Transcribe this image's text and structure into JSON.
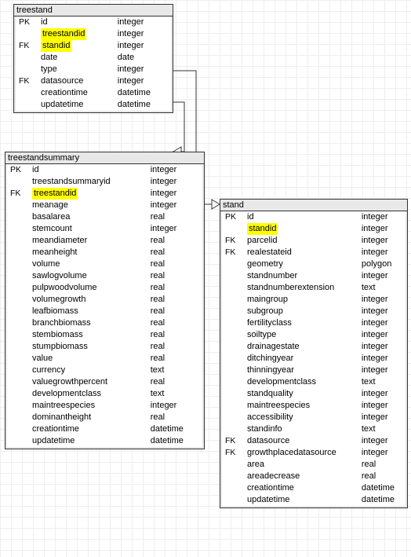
{
  "entities": {
    "treestand": {
      "title": "treestand",
      "rows": [
        {
          "key": "PK",
          "name": "id",
          "type": "integer",
          "hl": false
        },
        {
          "key": "",
          "name": "treestandid",
          "type": "integer",
          "hl": true
        },
        {
          "key": "FK",
          "name": "standid",
          "type": "integer",
          "hl": true
        },
        {
          "key": "",
          "name": "date",
          "type": "date",
          "hl": false
        },
        {
          "key": "",
          "name": "type",
          "type": "integer",
          "hl": false
        },
        {
          "key": "FK",
          "name": "datasource",
          "type": "integer",
          "hl": false
        },
        {
          "key": "",
          "name": "creationtime",
          "type": "datetime",
          "hl": false
        },
        {
          "key": "",
          "name": "updatetime",
          "type": "datetime",
          "hl": false
        }
      ]
    },
    "treestandsummary": {
      "title": "treestandsummary",
      "rows": [
        {
          "key": "PK",
          "name": "id",
          "type": "integer",
          "hl": false
        },
        {
          "key": "",
          "name": "treestandsummaryid",
          "type": "integer",
          "hl": false
        },
        {
          "key": "FK",
          "name": "treestandid",
          "type": "integer",
          "hl": true
        },
        {
          "key": "",
          "name": "meanage",
          "type": "integer",
          "hl": false
        },
        {
          "key": "",
          "name": "basalarea",
          "type": "real",
          "hl": false
        },
        {
          "key": "",
          "name": "stemcount",
          "type": "integer",
          "hl": false
        },
        {
          "key": "",
          "name": "meandiameter",
          "type": "real",
          "hl": false
        },
        {
          "key": "",
          "name": "meanheight",
          "type": "real",
          "hl": false
        },
        {
          "key": "",
          "name": "volume",
          "type": "real",
          "hl": false
        },
        {
          "key": "",
          "name": "sawlogvolume",
          "type": "real",
          "hl": false
        },
        {
          "key": "",
          "name": "pulpwoodvolume",
          "type": "real",
          "hl": false
        },
        {
          "key": "",
          "name": "volumegrowth",
          "type": "real",
          "hl": false
        },
        {
          "key": "",
          "name": "leafbiomass",
          "type": "real",
          "hl": false
        },
        {
          "key": "",
          "name": "branchbiomass",
          "type": "real",
          "hl": false
        },
        {
          "key": "",
          "name": "stembiomass",
          "type": "real",
          "hl": false
        },
        {
          "key": "",
          "name": "stumpbiomass",
          "type": "real",
          "hl": false
        },
        {
          "key": "",
          "name": "value",
          "type": "real",
          "hl": false
        },
        {
          "key": "",
          "name": "currency",
          "type": "text",
          "hl": false
        },
        {
          "key": "",
          "name": "valuegrowthpercent",
          "type": "real",
          "hl": false
        },
        {
          "key": "",
          "name": "developmentclass",
          "type": "text",
          "hl": false
        },
        {
          "key": "",
          "name": "maintreespecies",
          "type": "integer",
          "hl": false
        },
        {
          "key": "",
          "name": "dominantheight",
          "type": "real",
          "hl": false
        },
        {
          "key": "",
          "name": "creationtime",
          "type": "datetime",
          "hl": false
        },
        {
          "key": "",
          "name": "updatetime",
          "type": "datetime",
          "hl": false
        }
      ]
    },
    "stand": {
      "title": "stand",
      "rows": [
        {
          "key": "PK",
          "name": "id",
          "type": "integer",
          "hl": false
        },
        {
          "key": "",
          "name": "standid",
          "type": "integer",
          "hl": true
        },
        {
          "key": "FK",
          "name": "parcelid",
          "type": "integer",
          "hl": false
        },
        {
          "key": "FK",
          "name": "realestateid",
          "type": "integer",
          "hl": false
        },
        {
          "key": "",
          "name": "geometry",
          "type": "polygon",
          "hl": false
        },
        {
          "key": "",
          "name": "standnumber",
          "type": "integer",
          "hl": false
        },
        {
          "key": "",
          "name": "standnumberextension",
          "type": "text",
          "hl": false
        },
        {
          "key": "",
          "name": "maingroup",
          "type": "integer",
          "hl": false
        },
        {
          "key": "",
          "name": "subgroup",
          "type": "integer",
          "hl": false
        },
        {
          "key": "",
          "name": "fertilityclass",
          "type": "integer",
          "hl": false
        },
        {
          "key": "",
          "name": "soiltype",
          "type": "integer",
          "hl": false
        },
        {
          "key": "",
          "name": "drainagestate",
          "type": "integer",
          "hl": false
        },
        {
          "key": "",
          "name": "ditchingyear",
          "type": "integer",
          "hl": false
        },
        {
          "key": "",
          "name": "thinningyear",
          "type": "integer",
          "hl": false
        },
        {
          "key": "",
          "name": "developmentclass",
          "type": "text",
          "hl": false
        },
        {
          "key": "",
          "name": "standquality",
          "type": "integer",
          "hl": false
        },
        {
          "key": "",
          "name": "maintreespecies",
          "type": "integer",
          "hl": false
        },
        {
          "key": "",
          "name": "accessibility",
          "type": "integer",
          "hl": false
        },
        {
          "key": "",
          "name": "standinfo",
          "type": "text",
          "hl": false
        },
        {
          "key": "FK",
          "name": "datasource",
          "type": "integer",
          "hl": false
        },
        {
          "key": "FK",
          "name": "growthplacedatasource",
          "type": "integer",
          "hl": false
        },
        {
          "key": "",
          "name": "area",
          "type": "real",
          "hl": false
        },
        {
          "key": "",
          "name": "areadecrease",
          "type": "real",
          "hl": false
        },
        {
          "key": "",
          "name": "creationtime",
          "type": "datetime",
          "hl": false
        },
        {
          "key": "",
          "name": "updatetime",
          "type": "datetime",
          "hl": false
        }
      ]
    }
  }
}
